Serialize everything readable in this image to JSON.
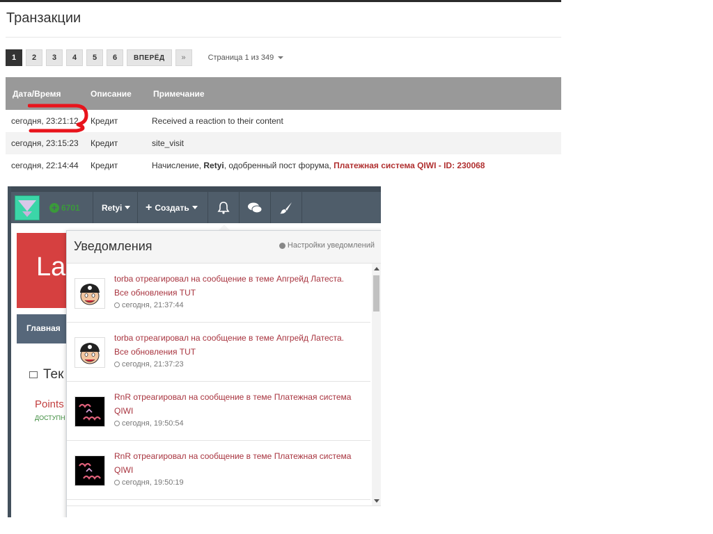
{
  "page_title": "Транзакции",
  "pager": {
    "pages": [
      "1",
      "2",
      "3",
      "4",
      "5",
      "6"
    ],
    "next_label": "ВПЕРЁД",
    "last_label": "»",
    "page_info": "Страница 1 из 349"
  },
  "table": {
    "headers": [
      "Дата/Время",
      "Описание",
      "Примечание"
    ],
    "rows": [
      {
        "date": "сегодня, 23:21:12",
        "desc": "Кредит",
        "note": "Received a reaction to their content"
      },
      {
        "date": "сегодня, 23:15:23",
        "desc": "Кредит",
        "note": "site_visit"
      },
      {
        "date": "сегодня, 22:14:44",
        "desc": "Кредит",
        "note_pre": "Начисление, ",
        "note_user": "Retyi",
        "note_mid": ", одобренный пост форума, ",
        "note_link": "Платежная система QIWI - ID: 230068"
      }
    ]
  },
  "forum": {
    "points": "6701",
    "user": "Retyi",
    "create": "Создать",
    "banner_text": "La",
    "nav_home": "Главная",
    "section_title": "Тек",
    "points_label": "Points",
    "available_label": "ДОСТУПН"
  },
  "notifications": {
    "title": "Уведомления",
    "settings": "Настройки уведомлений",
    "items": [
      {
        "line1": "torba отреагировал на сообщение в теме Апгрейд Латеста.",
        "line2": "Все обновления TUT",
        "time": "сегодня, 21:37:44",
        "avatar": "torba"
      },
      {
        "line1": "torba отреагировал на сообщение в теме Апгрейд Латеста.",
        "line2": "Все обновления TUT",
        "time": "сегодня, 21:37:23",
        "avatar": "torba"
      },
      {
        "line1": "RnR отреагировал на сообщение в теме Платежная система",
        "line2": "QIWI",
        "time": "сегодня, 19:50:54",
        "avatar": "rnr"
      },
      {
        "line1": "RnR отреагировал на сообщение в теме Платежная система",
        "line2": "QIWI",
        "time": "сегодня, 19:50:19",
        "avatar": "rnr"
      }
    ]
  },
  "colors": {
    "header_bg": "#999999",
    "link_red": "#a8343f",
    "forum_bar": "#4f5d6a",
    "annotation_red": "#e8141c"
  }
}
